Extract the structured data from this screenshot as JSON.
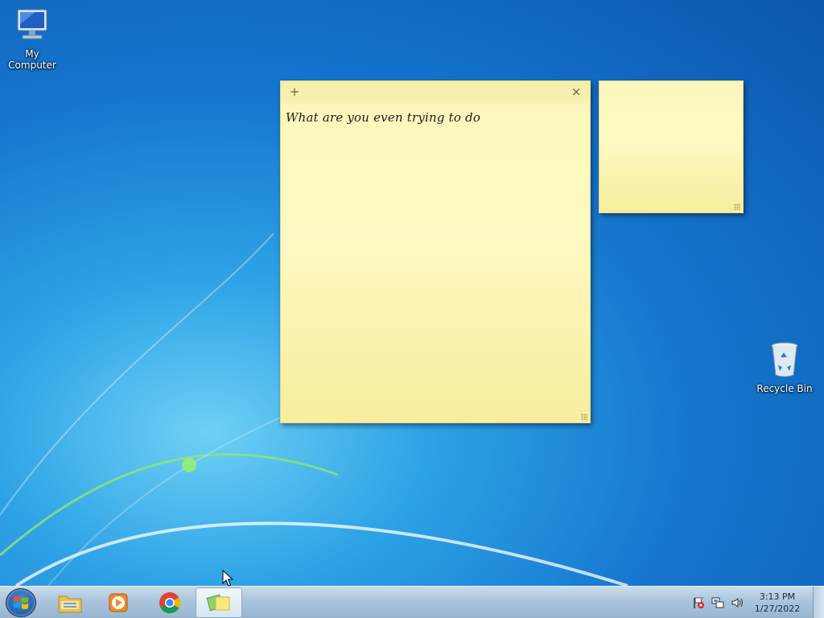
{
  "desktop": {
    "icons": [
      {
        "label": "My Computer",
        "icon": "computer-icon"
      },
      {
        "label": "Recycle Bin",
        "icon": "recycle-bin-icon"
      }
    ]
  },
  "notes": [
    {
      "text": "What are you even trying to do",
      "add_label": "+",
      "close_label": "×"
    },
    {
      "text": ""
    }
  ],
  "taskbar": {
    "pinned": [
      {
        "name": "start-button",
        "icon": "windows-logo-icon"
      },
      {
        "name": "windows-explorer",
        "icon": "folder-icon"
      },
      {
        "name": "windows-media-player",
        "icon": "media-player-icon"
      },
      {
        "name": "google-chrome",
        "icon": "chrome-icon"
      },
      {
        "name": "sticky-notes",
        "icon": "sticky-notes-icon",
        "active": true
      }
    ],
    "tray": {
      "icons": [
        "action-center-flag-icon",
        "network-icon",
        "volume-icon"
      ],
      "time": "3:13 PM",
      "date": "1/27/2022"
    }
  },
  "colors": {
    "note_yellow": "#fdf9c2",
    "desktop_blue": "#1677cf",
    "taskbar": "#a9c3db"
  }
}
